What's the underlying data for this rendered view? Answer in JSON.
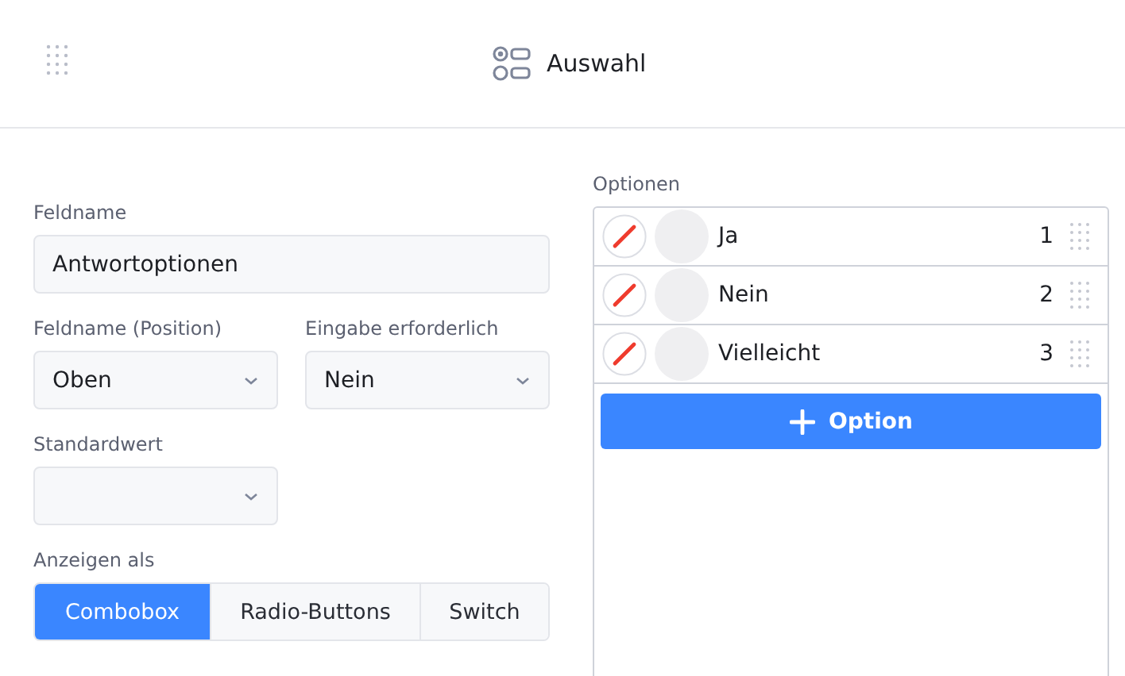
{
  "header": {
    "title": "Auswahl"
  },
  "form": {
    "name": {
      "label": "Feldname",
      "value": "Antwortoptionen"
    },
    "label_position": {
      "label": "Feldname (Position)",
      "value": "Oben"
    },
    "required": {
      "label": "Eingabe erforderlich",
      "value": "Nein"
    },
    "default": {
      "label": "Standardwert"
    },
    "display": {
      "label": "Anzeigen als",
      "options": [
        {
          "label": "Combobox",
          "selected": true
        },
        {
          "label": "Radio-Buttons",
          "selected": false
        },
        {
          "label": "Switch",
          "selected": false
        }
      ]
    }
  },
  "options": {
    "label": "Optionen",
    "items": [
      {
        "label": "Ja",
        "number": "1"
      },
      {
        "label": "Nein",
        "number": "2"
      },
      {
        "label": "Vielleicht",
        "number": "3"
      }
    ],
    "add_button": "Option"
  }
}
